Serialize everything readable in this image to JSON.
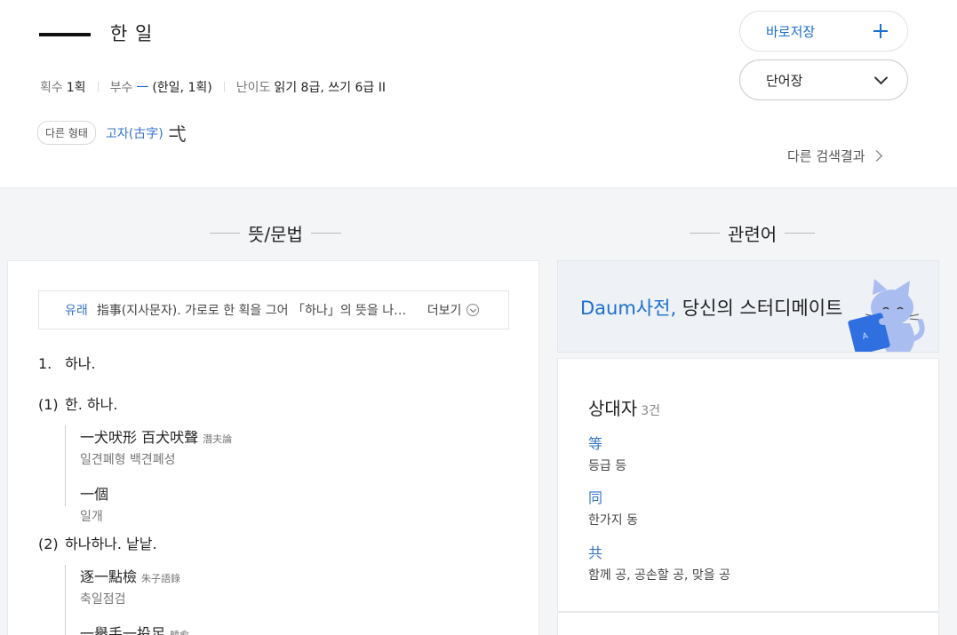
{
  "header": {
    "reading": "한 일",
    "stroke_label": "획수",
    "stroke_value": "1획",
    "radical_label": "부수",
    "radical_char": "一",
    "radical_value": "(한일, 1획)",
    "difficulty_label": "난이도",
    "difficulty_value": "읽기 8급, 쓰기 6급 II",
    "alt_badge": "다른 형태",
    "alt_label": "고자(古字)",
    "alt_char": "弌",
    "save_label": "바로저장",
    "wordbook_label": "단어장",
    "other_results": "다른 검색결과"
  },
  "sections": {
    "meaning_title": "뜻/문법",
    "related_title": "관련어"
  },
  "origin": {
    "label": "유래",
    "text": "指事(지사문자). 가로로 한 획을 그어 「하나」의 뜻을 나타…",
    "more": "더보기"
  },
  "meanings": {
    "main_num": "1.",
    "main_text": "하나.",
    "subs": [
      {
        "num": "(1)",
        "text": "한. 하나.",
        "examples": [
          {
            "hanja": "一犬吠形 百犬吠聲",
            "source": "潛夫論",
            "reading": "일견폐형 백견폐성"
          },
          {
            "hanja": "一個",
            "source": "",
            "reading": "일개"
          }
        ]
      },
      {
        "num": "(2)",
        "text": "하나하나. 낱낱.",
        "examples": [
          {
            "hanja": "逐一點檢",
            "source": "朱子語錄",
            "reading": "축일점검"
          },
          {
            "hanja": "一擧手一投足",
            "source": "韓愈",
            "reading": ""
          }
        ]
      }
    ]
  },
  "banner": {
    "brand": "Daum사전,",
    "text": " 당신의 스터디메이트"
  },
  "related": {
    "title": "상대자",
    "count": "3건",
    "items": [
      {
        "hanja": "等",
        "reading": "등급 등"
      },
      {
        "hanja": "同",
        "reading": "한가지 동"
      },
      {
        "hanja": "共",
        "reading": "함께 공, 공손할 공, 맞을 공"
      }
    ]
  },
  "colors": {
    "accent": "#1b6fd1",
    "link": "#3574c7",
    "background": "#f4f5f7"
  }
}
